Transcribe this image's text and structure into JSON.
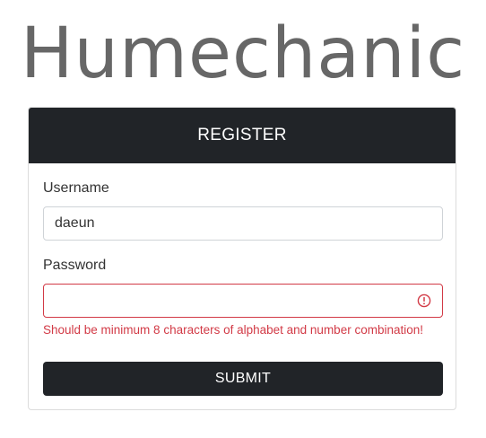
{
  "brand": {
    "title": "Humechanic"
  },
  "register_card": {
    "header_title": "REGISTER",
    "username": {
      "label": "Username",
      "value": "daeun"
    },
    "password": {
      "label": "Password",
      "value": "",
      "state": "invalid",
      "error_icon": "exclamation-circle-icon",
      "error_message": "Should be minimum 8 characters of alphabet and number combination!"
    },
    "submit_label": "SUBMIT"
  },
  "colors": {
    "dark": "#212428",
    "error": "#d23a46",
    "border": "#cfd3d7",
    "title_text": "#5f5f5f"
  }
}
